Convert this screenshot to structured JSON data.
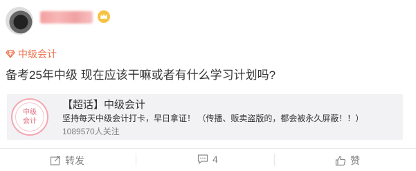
{
  "post": {
    "author": {
      "name": "",
      "avatar": "user-avatar-blurred",
      "badge_icon": "vip-crown-icon"
    },
    "topic_tag": {
      "icon": "diamond-icon",
      "label": "中级会计"
    },
    "text": "备考25年中级 现在应该干嘛或者有什么学习计划吗?"
  },
  "card": {
    "logo_line1": "中级",
    "logo_line2": "会计",
    "title": "【超话】中级会计",
    "description": "坚持每天中级会计打卡，早日拿证！  （传播、贩卖盗版的，都会被永久屏蔽！！）",
    "followers": "1089570人关注"
  },
  "actions": {
    "share": {
      "icon": "share-icon",
      "label": "转发"
    },
    "comment": {
      "icon": "comment-icon",
      "label": "4"
    },
    "like": {
      "icon": "like-icon",
      "label": "赞"
    }
  },
  "colors": {
    "accent": "#eb7350",
    "card_bg": "#f2f2f5",
    "muted": "#808080"
  }
}
